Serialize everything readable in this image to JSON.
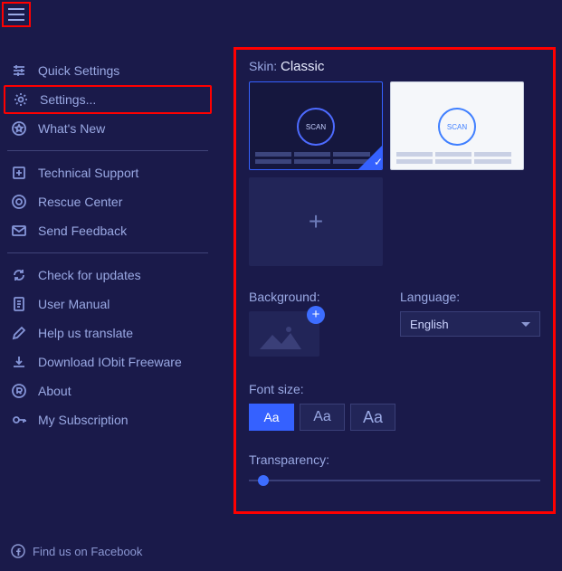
{
  "menu": {
    "quick_settings": "Quick Settings",
    "settings": "Settings...",
    "whats_new": "What's New",
    "tech_support": "Technical Support",
    "rescue_center": "Rescue Center",
    "send_feedback": "Send Feedback",
    "check_updates": "Check for updates",
    "user_manual": "User Manual",
    "help_translate": "Help us translate",
    "download_freeware": "Download IObit Freeware",
    "about": "About",
    "my_subscription": "My Subscription"
  },
  "settings": {
    "skin_label": "Skin:",
    "skin_value": "Classic",
    "scan_text": "SCAN",
    "add_plus": "+",
    "background_label": "Background:",
    "language_label": "Language:",
    "language_value": "English",
    "font_label": "Font size:",
    "font_sample": "Aa",
    "transparency_label": "Transparency:"
  },
  "footer": {
    "facebook": "Find us on Facebook"
  }
}
